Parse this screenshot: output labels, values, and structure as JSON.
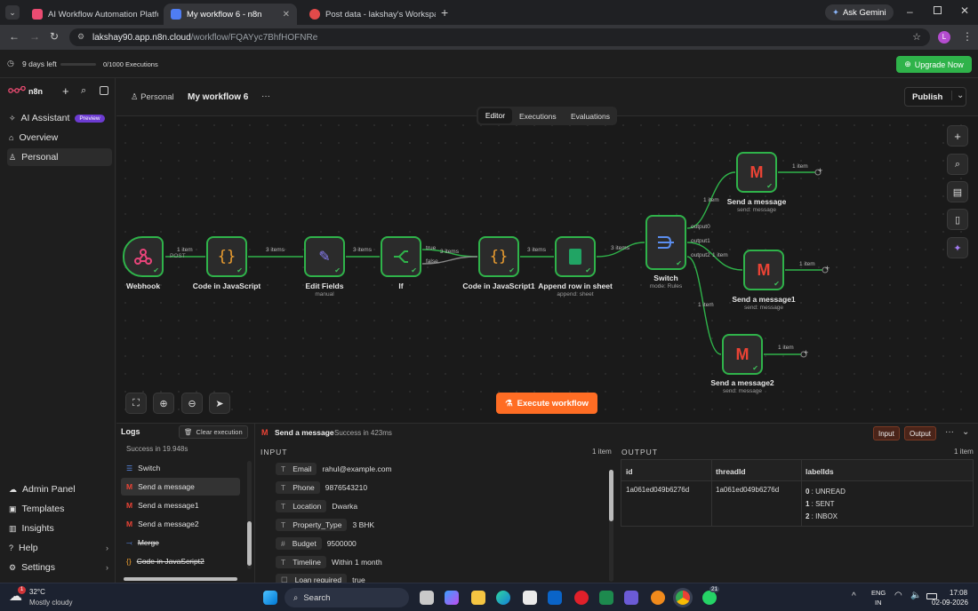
{
  "browser": {
    "tabs": [
      {
        "title": "AI Workflow Automation Platfo",
        "color": "#ea4b71"
      },
      {
        "title": "My workflow 6 - n8n",
        "color": "#4f7df3"
      },
      {
        "title": "Post data - lakshay's Workspac",
        "color": "#e24a4a"
      }
    ],
    "ask_gemini": "Ask Gemini",
    "url_domain": "lakshay90.app.n8n.cloud",
    "url_path": "/workflow/FQAYyc7BhfHOFNRe",
    "profile_initial": "L"
  },
  "trial": {
    "days_left": "9 days left",
    "executions": "0/1000 Executions",
    "upgrade_label": "Upgrade Now"
  },
  "sidebar": {
    "brand": "n8n",
    "items": [
      {
        "label": "AI Assistant",
        "badge": "Preview",
        "icon": "sparkle-icon"
      },
      {
        "label": "Overview",
        "icon": "home-icon"
      },
      {
        "label": "Personal",
        "icon": "user-icon"
      }
    ],
    "bottom": [
      {
        "label": "Admin Panel",
        "icon": "cloud-icon"
      },
      {
        "label": "Templates",
        "icon": "box-icon"
      },
      {
        "label": "Insights",
        "icon": "chart-icon"
      },
      {
        "label": "Help",
        "icon": "help-icon"
      },
      {
        "label": "Settings",
        "icon": "gear-icon"
      }
    ]
  },
  "header": {
    "project": "Personal",
    "workflow_name": "My workflow 6",
    "more": "···",
    "publish_label": "Publish",
    "tabs": [
      "Editor",
      "Executions",
      "Evaluations"
    ]
  },
  "canvas": {
    "nodes": [
      {
        "name": "Webhook",
        "sub": ""
      },
      {
        "name": "Code in JavaScript",
        "sub": ""
      },
      {
        "name": "Edit Fields",
        "sub": "manual"
      },
      {
        "name": "If",
        "sub": ""
      },
      {
        "name": "Code in JavaScript1",
        "sub": ""
      },
      {
        "name": "Append row in sheet",
        "sub": "append: sheet"
      },
      {
        "name": "Switch",
        "sub": "mode: Rules"
      },
      {
        "name": "Send a message",
        "sub": "send: message"
      },
      {
        "name": "Send a message1",
        "sub": "send: message"
      },
      {
        "name": "Send a message2",
        "sub": "send: message"
      }
    ],
    "edge_labels": {
      "e1": "1 item",
      "e1b": "POST",
      "e2": "3 items",
      "e3": "3 items",
      "e4": "3 items",
      "e5": "3 items",
      "e6": "3 items",
      "true": "true",
      "false": "false",
      "o0": "output0",
      "o1": "output1",
      "o2": "output2",
      "s0": "1 item",
      "s1": "1 item",
      "s2": "1 item",
      "m0": "1 item",
      "m1": "1 item",
      "m2": "1 item"
    },
    "execute_label": "Execute workflow"
  },
  "logs": {
    "title": "Logs",
    "clear_label": "Clear execution",
    "status": "Success in 19.948s",
    "items": [
      {
        "label": "Switch",
        "icon": "switch-icon"
      },
      {
        "label": "Send a message",
        "icon": "gmail-icon"
      },
      {
        "label": "Send a message1",
        "icon": "gmail-icon"
      },
      {
        "label": "Send a message2",
        "icon": "gmail-icon"
      },
      {
        "label": "Merge",
        "icon": "merge-icon"
      },
      {
        "label": "Code in JavaScript2",
        "icon": "code-icon"
      }
    ]
  },
  "detail": {
    "node_name": "Send a message",
    "status": "Success in 423ms",
    "input_label": "Input",
    "output_label": "Output",
    "input": {
      "title": "INPUT",
      "count": "1 item",
      "fields": [
        {
          "type": "T",
          "key": "Email",
          "value": "rahul@example.com"
        },
        {
          "type": "T",
          "key": "Phone",
          "value": "9876543210"
        },
        {
          "type": "T",
          "key": "Location",
          "value": "Dwarka"
        },
        {
          "type": "T",
          "key": "Property_Type",
          "value": "3 BHK"
        },
        {
          "type": "#",
          "key": "Budget",
          "value": "9500000"
        },
        {
          "type": "T",
          "key": "Timeline",
          "value": "Within 1 month"
        },
        {
          "type": "☐",
          "key": "Loan required",
          "value": "true"
        }
      ]
    },
    "output": {
      "title": "OUTPUT",
      "count": "1 item",
      "columns": [
        "id",
        "threadId",
        "labelIds"
      ],
      "row": {
        "id": "1a061ed049b6276d",
        "threadId": "1a061ed049b6276d",
        "labels": [
          {
            "idx": "0",
            "val": "UNREAD"
          },
          {
            "idx": "1",
            "val": "SENT"
          },
          {
            "idx": "2",
            "val": "INBOX"
          }
        ]
      }
    }
  },
  "taskbar": {
    "weather_temp": "32°C",
    "weather_desc": "Mostly cloudy",
    "search": "Search",
    "lang1": "ENG",
    "lang2": "IN",
    "time": "17:08",
    "date": "02-09-2026",
    "badge": "21"
  }
}
